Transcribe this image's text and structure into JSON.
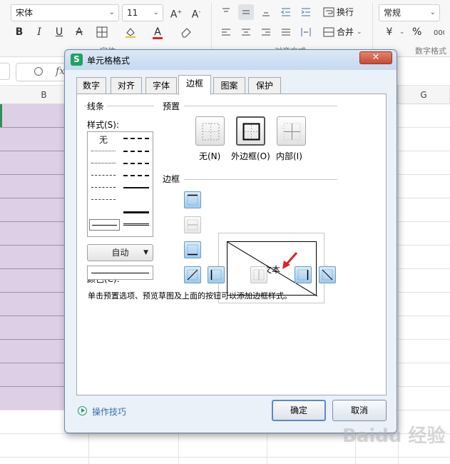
{
  "ribbon": {
    "font_name": "宋体",
    "font_size": "11",
    "wrap_label": "换行",
    "merge_label": "合并",
    "number_format": "常规",
    "group_font": "字体",
    "group_align": "对齐方式",
    "group_number": "数字格式",
    "percent_symbol": "%"
  },
  "formula_bar": {
    "fx": "fx"
  },
  "sheet": {
    "columns": [
      {
        "label": "B"
      },
      {
        "label": "G"
      }
    ],
    "fill_color": "#ddd0e6"
  },
  "dialog": {
    "title": "单元格格式",
    "app_icon_letter": "S",
    "close_glyph": "✕",
    "tabs": [
      {
        "label": "数字"
      },
      {
        "label": "对齐"
      },
      {
        "label": "字体"
      },
      {
        "label": "边框",
        "active": true
      },
      {
        "label": "图案"
      },
      {
        "label": "保护"
      }
    ],
    "line_group": "线条",
    "style_label": "样式(S):",
    "none_label": "无",
    "color_label": "颜色(C):",
    "color_value": "自动",
    "preset_group": "预置",
    "presets": [
      {
        "label": "无(N)",
        "icon": "border-none-icon"
      },
      {
        "label": "外边框(O)",
        "icon": "border-outline-icon"
      },
      {
        "label": "内部(I)",
        "icon": "border-inside-icon"
      }
    ],
    "border_group": "边框",
    "preview_text": "文本",
    "hint": "单击预置选项、预览草图及上面的按钮可以添加边框样式。",
    "tips": "操作技巧",
    "ok": "确定",
    "cancel": "取消"
  },
  "colors": {
    "accent_blue": "#9ecbee",
    "arrow_red": "#e02020",
    "app_green": "#1ea362"
  },
  "watermark": "Baidu 经验"
}
